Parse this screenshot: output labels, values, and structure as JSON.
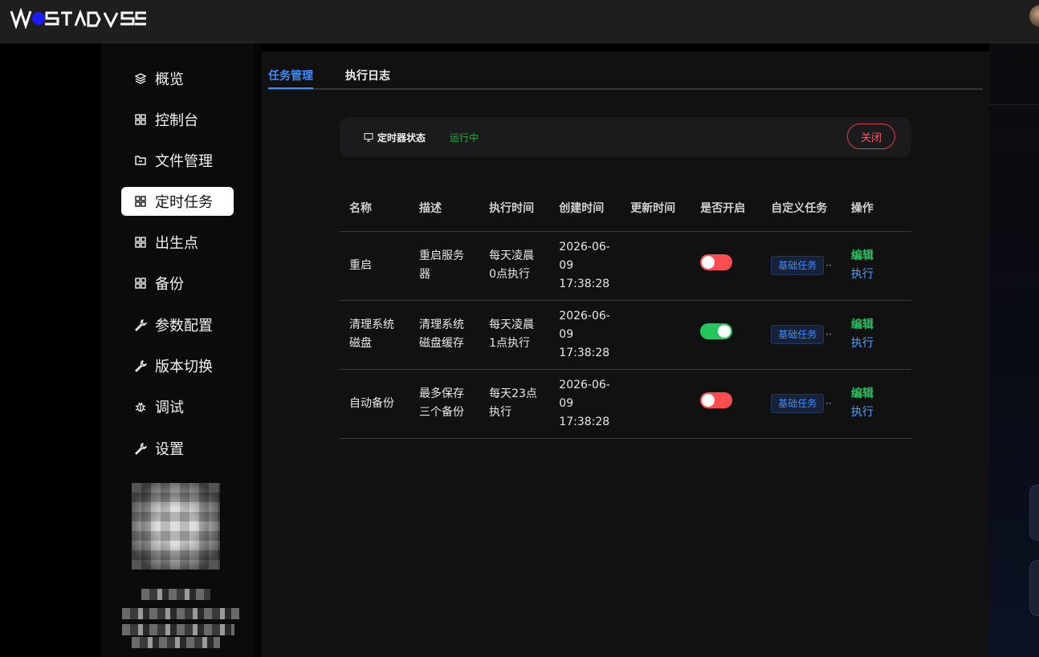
{
  "header": {
    "logo_text": "WOSTADUSS"
  },
  "sidebar": {
    "items": [
      {
        "label": "概览",
        "icon": "layers-icon",
        "active": false
      },
      {
        "label": "控制台",
        "icon": "grid-icon",
        "active": false
      },
      {
        "label": "文件管理",
        "icon": "folder-icon",
        "active": false
      },
      {
        "label": "定时任务",
        "icon": "grid-icon",
        "active": true
      },
      {
        "label": "出生点",
        "icon": "grid-icon",
        "active": false
      },
      {
        "label": "备份",
        "icon": "grid-icon",
        "active": false
      },
      {
        "label": "参数配置",
        "icon": "wrench-icon",
        "active": false
      },
      {
        "label": "版本切换",
        "icon": "wrench-icon",
        "active": false
      },
      {
        "label": "调试",
        "icon": "bug-icon",
        "active": false
      },
      {
        "label": "设置",
        "icon": "wrench-icon",
        "active": false
      }
    ]
  },
  "tabs": [
    {
      "label": "任务管理",
      "active": true
    },
    {
      "label": "执行日志",
      "active": false
    }
  ],
  "timer": {
    "label": "定时器状态",
    "status": "运行中",
    "close_label": "关闭"
  },
  "table": {
    "headers": [
      "名称",
      "描述",
      "执行时间",
      "创建时间",
      "更新时间",
      "是否开启",
      "自定义任务",
      "操作"
    ],
    "rows": [
      {
        "name": "重启",
        "desc": "重启服务器",
        "exec_time": "每天凌晨0点执行",
        "created": "2026-06-09 17:38:28",
        "updated": "",
        "enabled": false,
        "custom_tag": "基础任务",
        "edit": "编辑",
        "run": "执行"
      },
      {
        "name": "清理系统磁盘",
        "desc": "清理系统磁盘缓存",
        "exec_time": "每天凌晨1点执行",
        "created": "2026-06-09 17:38:28",
        "updated": "",
        "enabled": true,
        "custom_tag": "基础任务",
        "edit": "编辑",
        "run": "执行"
      },
      {
        "name": "自动备份",
        "desc": "最多保存三个备份",
        "exec_time": "每天23点执行",
        "created": "2026-06-09 17:38:28",
        "updated": "",
        "enabled": false,
        "custom_tag": "基础任务",
        "edit": "编辑",
        "run": "执行"
      }
    ]
  },
  "colors": {
    "accent": "#3b8cff",
    "toggle_on": "#22c55e",
    "toggle_off": "#ff4d4f",
    "status_running": "#2aa84a"
  }
}
